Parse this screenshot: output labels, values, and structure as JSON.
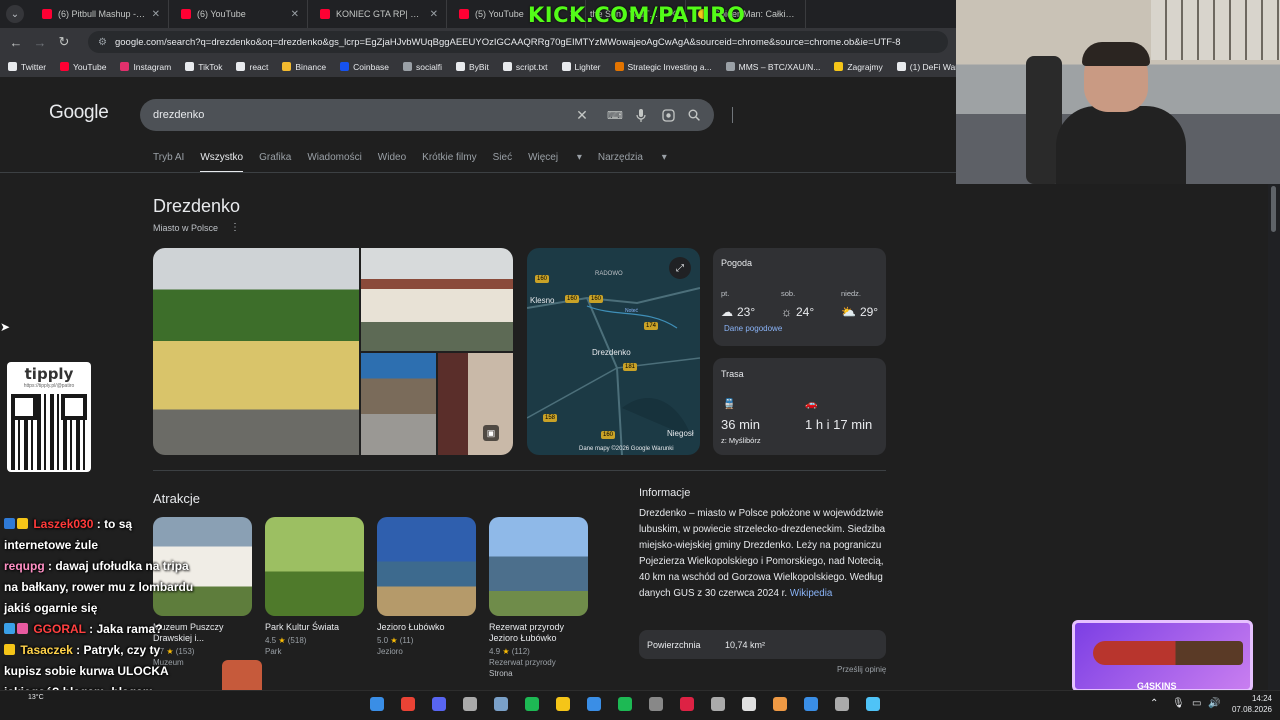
{
  "browser": {
    "tabs": [
      {
        "label": "(6) Pitbull Mashup - YouTube",
        "icon": "youtube-icon"
      },
      {
        "label": "(6) YouTube",
        "icon": "youtube-icon"
      },
      {
        "label": "KONIEC GTA RP| MAMMO",
        "icon": "youtube-icon"
      },
      {
        "label": "(5) YouTube",
        "icon": "youtube-icon"
      },
      {
        "label": "the Sun - YouTube",
        "icon": "youtube-icon"
      },
      {
        "label": "Spider-Man: Całkiem",
        "icon": "sun-icon"
      }
    ],
    "overlay_url": "KICK.COM/PATIRO",
    "url": "google.com/search?q=drezdenko&oq=drezdenko&gs_lcrp=EgZjaHJvbWUqBggAEEUYOzIGCAAQRRg70gEIMTYzMWowajeoAgCwAgA&sourceid=chrome&source=chrome.ob&ie=UTF-8",
    "bookmarks": [
      {
        "label": "Twitter",
        "color": "#e8eaed"
      },
      {
        "label": "YouTube",
        "color": "#ff0033"
      },
      {
        "label": "Instagram",
        "color": "#e1306c"
      },
      {
        "label": "TikTok",
        "color": "#e8eaed"
      },
      {
        "label": "react",
        "color": "#e8eaed"
      },
      {
        "label": "Binance",
        "color": "#f3ba2f"
      },
      {
        "label": "Coinbase",
        "color": "#1652f0"
      },
      {
        "label": "socialfi",
        "color": "#9aa0a6"
      },
      {
        "label": "ByBit",
        "color": "#e8eaed"
      },
      {
        "label": "script.txt",
        "color": "#e8eaed"
      },
      {
        "label": "Lighter",
        "color": "#e8eaed"
      },
      {
        "label": "Strategic Investing a...",
        "color": "#e37400"
      },
      {
        "label": "MMS – BTC/XAU/N...",
        "color": "#9aa0a6"
      },
      {
        "label": "Zagrajmy",
        "color": "#f5c518"
      },
      {
        "label": "(1) DeFi Warhol on...",
        "color": "#e8eaed"
      }
    ]
  },
  "google": {
    "logo": "Google",
    "query": "drezdenko",
    "tabs": [
      "Tryb AI",
      "Wszystko",
      "Grafika",
      "Wiadomości",
      "Wideo",
      "Krótkie filmy",
      "Sieć",
      "Więcej",
      "Narzędzia"
    ],
    "active_tab": "Wszystko"
  },
  "knowledge": {
    "title": "Drezdenko",
    "subtitle": "Miasto w Polsce",
    "map": {
      "labels": {
        "radowo": "RADOWO",
        "klesno": "Klesno",
        "drezdenko": "Drezdenko",
        "niegosl": "Niegosł",
        "notec": "Noteć"
      },
      "roads": [
        "160",
        "160",
        "160",
        "174",
        "181",
        "158",
        "160"
      ],
      "footer": "Dane mapy ©2026 Google   Warunki"
    },
    "weather": {
      "title": "Pogoda",
      "days": [
        {
          "day": "pt.",
          "temp": "23°",
          "icon": "cloud-icon"
        },
        {
          "day": "sob.",
          "temp": "24°",
          "icon": "sun-icon"
        },
        {
          "day": "niedz.",
          "temp": "29°",
          "icon": "partly-sunny-icon"
        }
      ],
      "link": "Dane pogodowe"
    },
    "route": {
      "title": "Trasa",
      "transit": {
        "time": "36 min",
        "from": "z: Myślibórz"
      },
      "car": {
        "time": "1 h i 17 min"
      }
    }
  },
  "attractions": {
    "title": "Atrakcje",
    "items": [
      {
        "name": "Muzeum Puszczy Drawskiej i...",
        "rating": "4.7",
        "reviews": "(153)",
        "type": "Muzeum"
      },
      {
        "name": "Park Kultur Świata",
        "rating": "4.5",
        "reviews": "(518)",
        "type": "Park"
      },
      {
        "name": "Jezioro Łubówko",
        "rating": "5.0",
        "reviews": "(11)",
        "type": "Jezioro"
      },
      {
        "name": "Rezerwat przyrody Jezioro Łubówko",
        "rating": "4.9",
        "reviews": "(112)",
        "type": "Rezerwat przyrody",
        "extra": "Strona"
      }
    ]
  },
  "info": {
    "title": "Informacje",
    "text": "Drezdenko – miasto w Polsce położone w województwie lubuskim, w powiecie strzelecko-drezdeneckim. Siedziba miejsko-wiejskiej gminy Drezdenko. Leży na pograniczu Pojezierza Wielkopolskiego i Pomorskiego, nad Notecią, 40 km na wschód od Gorzowa Wielkopolskiego. Według danych GUS z 30 czerwca 2024 r. ",
    "source": "Wikipedia",
    "area_label": "Powierzchnia",
    "area_value": "10,74 km²",
    "feedback": "Prześlij opinię"
  },
  "stream": {
    "tipply": {
      "brand": "tipply",
      "url": "https://tipply.pl/@patiro"
    },
    "chat": [
      {
        "user": "Laszek030",
        "msg": ": to są internetowe żule"
      },
      {
        "user": "requpg",
        "msg": ": dawaj ufołudka na tripa na bałkany, rower mu z lombardu jakiś ogarnie się"
      },
      {
        "user": "GGORAL",
        "msg": ": Jaka rama?"
      },
      {
        "user": "Tasaczek",
        "msg": ": Patryk, czy ty kupisz sobie kurwa ULOCKA jakiegoś? blagam, blagam"
      }
    ],
    "emote_count": "x5",
    "sponsor": "G4SKINS"
  },
  "taskbar": {
    "weather": "13°C",
    "time": "14:24",
    "date": "07.08.2026"
  }
}
